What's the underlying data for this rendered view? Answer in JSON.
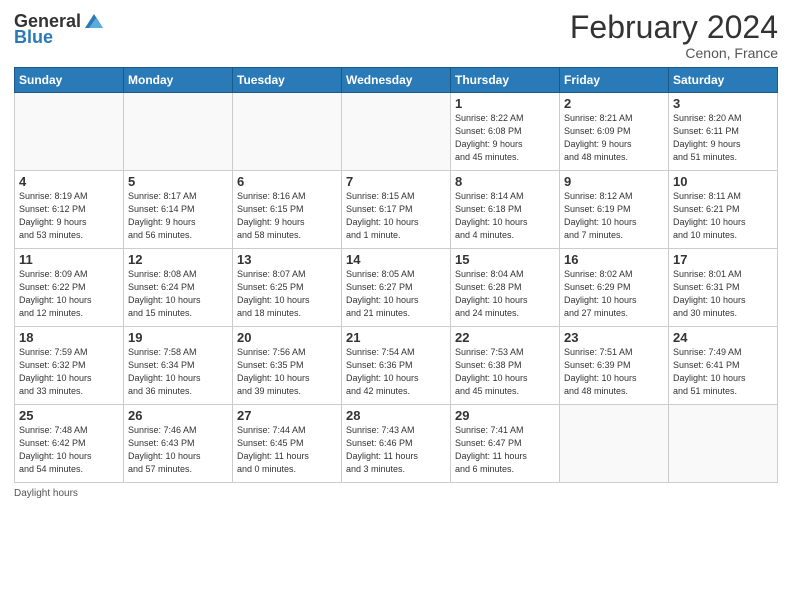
{
  "header": {
    "logo_general": "General",
    "logo_blue": "Blue",
    "month_title": "February 2024",
    "location": "Cenon, France"
  },
  "footer": {
    "daylight_label": "Daylight hours"
  },
  "days_of_week": [
    "Sunday",
    "Monday",
    "Tuesday",
    "Wednesday",
    "Thursday",
    "Friday",
    "Saturday"
  ],
  "weeks": [
    [
      {
        "day": "",
        "info": ""
      },
      {
        "day": "",
        "info": ""
      },
      {
        "day": "",
        "info": ""
      },
      {
        "day": "",
        "info": ""
      },
      {
        "day": "1",
        "info": "Sunrise: 8:22 AM\nSunset: 6:08 PM\nDaylight: 9 hours\nand 45 minutes."
      },
      {
        "day": "2",
        "info": "Sunrise: 8:21 AM\nSunset: 6:09 PM\nDaylight: 9 hours\nand 48 minutes."
      },
      {
        "day": "3",
        "info": "Sunrise: 8:20 AM\nSunset: 6:11 PM\nDaylight: 9 hours\nand 51 minutes."
      }
    ],
    [
      {
        "day": "4",
        "info": "Sunrise: 8:19 AM\nSunset: 6:12 PM\nDaylight: 9 hours\nand 53 minutes."
      },
      {
        "day": "5",
        "info": "Sunrise: 8:17 AM\nSunset: 6:14 PM\nDaylight: 9 hours\nand 56 minutes."
      },
      {
        "day": "6",
        "info": "Sunrise: 8:16 AM\nSunset: 6:15 PM\nDaylight: 9 hours\nand 58 minutes."
      },
      {
        "day": "7",
        "info": "Sunrise: 8:15 AM\nSunset: 6:17 PM\nDaylight: 10 hours\nand 1 minute."
      },
      {
        "day": "8",
        "info": "Sunrise: 8:14 AM\nSunset: 6:18 PM\nDaylight: 10 hours\nand 4 minutes."
      },
      {
        "day": "9",
        "info": "Sunrise: 8:12 AM\nSunset: 6:19 PM\nDaylight: 10 hours\nand 7 minutes."
      },
      {
        "day": "10",
        "info": "Sunrise: 8:11 AM\nSunset: 6:21 PM\nDaylight: 10 hours\nand 10 minutes."
      }
    ],
    [
      {
        "day": "11",
        "info": "Sunrise: 8:09 AM\nSunset: 6:22 PM\nDaylight: 10 hours\nand 12 minutes."
      },
      {
        "day": "12",
        "info": "Sunrise: 8:08 AM\nSunset: 6:24 PM\nDaylight: 10 hours\nand 15 minutes."
      },
      {
        "day": "13",
        "info": "Sunrise: 8:07 AM\nSunset: 6:25 PM\nDaylight: 10 hours\nand 18 minutes."
      },
      {
        "day": "14",
        "info": "Sunrise: 8:05 AM\nSunset: 6:27 PM\nDaylight: 10 hours\nand 21 minutes."
      },
      {
        "day": "15",
        "info": "Sunrise: 8:04 AM\nSunset: 6:28 PM\nDaylight: 10 hours\nand 24 minutes."
      },
      {
        "day": "16",
        "info": "Sunrise: 8:02 AM\nSunset: 6:29 PM\nDaylight: 10 hours\nand 27 minutes."
      },
      {
        "day": "17",
        "info": "Sunrise: 8:01 AM\nSunset: 6:31 PM\nDaylight: 10 hours\nand 30 minutes."
      }
    ],
    [
      {
        "day": "18",
        "info": "Sunrise: 7:59 AM\nSunset: 6:32 PM\nDaylight: 10 hours\nand 33 minutes."
      },
      {
        "day": "19",
        "info": "Sunrise: 7:58 AM\nSunset: 6:34 PM\nDaylight: 10 hours\nand 36 minutes."
      },
      {
        "day": "20",
        "info": "Sunrise: 7:56 AM\nSunset: 6:35 PM\nDaylight: 10 hours\nand 39 minutes."
      },
      {
        "day": "21",
        "info": "Sunrise: 7:54 AM\nSunset: 6:36 PM\nDaylight: 10 hours\nand 42 minutes."
      },
      {
        "day": "22",
        "info": "Sunrise: 7:53 AM\nSunset: 6:38 PM\nDaylight: 10 hours\nand 45 minutes."
      },
      {
        "day": "23",
        "info": "Sunrise: 7:51 AM\nSunset: 6:39 PM\nDaylight: 10 hours\nand 48 minutes."
      },
      {
        "day": "24",
        "info": "Sunrise: 7:49 AM\nSunset: 6:41 PM\nDaylight: 10 hours\nand 51 minutes."
      }
    ],
    [
      {
        "day": "25",
        "info": "Sunrise: 7:48 AM\nSunset: 6:42 PM\nDaylight: 10 hours\nand 54 minutes."
      },
      {
        "day": "26",
        "info": "Sunrise: 7:46 AM\nSunset: 6:43 PM\nDaylight: 10 hours\nand 57 minutes."
      },
      {
        "day": "27",
        "info": "Sunrise: 7:44 AM\nSunset: 6:45 PM\nDaylight: 11 hours\nand 0 minutes."
      },
      {
        "day": "28",
        "info": "Sunrise: 7:43 AM\nSunset: 6:46 PM\nDaylight: 11 hours\nand 3 minutes."
      },
      {
        "day": "29",
        "info": "Sunrise: 7:41 AM\nSunset: 6:47 PM\nDaylight: 11 hours\nand 6 minutes."
      },
      {
        "day": "",
        "info": ""
      },
      {
        "day": "",
        "info": ""
      }
    ]
  ]
}
